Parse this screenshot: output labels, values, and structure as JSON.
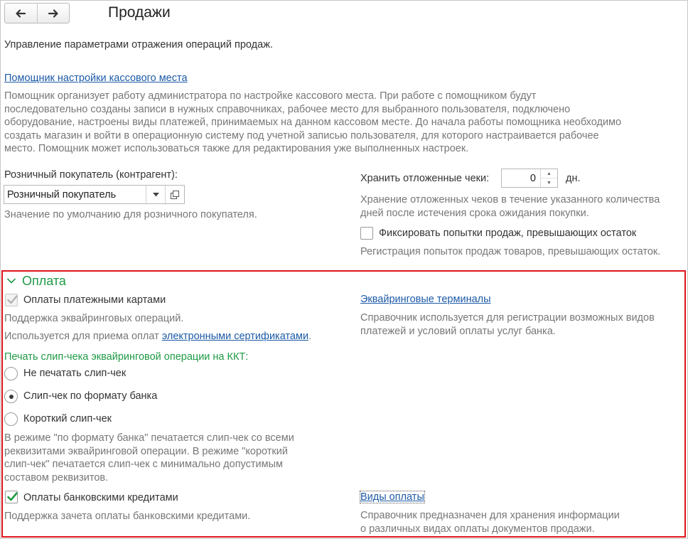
{
  "header": {
    "title": "Продажи",
    "back_icon": "arrow-left-icon",
    "forward_icon": "arrow-right-icon"
  },
  "description": "Управление параметрами отражения операций продаж.",
  "assistant": {
    "link": "Помощник настройки кассового места",
    "text_lines": [
      "Помощник организует работу администратора по настройке кассового места. При работе с помощником будут",
      "последовательно созданы записи в нужных справочниках, рабочее место для выбранного пользователя, подключено",
      "оборудование, настроены виды платежей, принимаемых на данном кассовом месте. До начала работы помощника необходимо",
      "создать магазин и войти в операционную систему под учетной записью пользователя, для которого настраивается рабочее",
      "место. Помощник может использоваться также для редактирования уже выполненных настроек."
    ]
  },
  "retail_buyer": {
    "label": "Розничный покупатель (контрагент):",
    "value": "Розничный покупатель",
    "hint": "Значение по умолчанию для розничного покупателя."
  },
  "deferred_checks": {
    "label": "Хранить отложенные чеки:",
    "value": "0",
    "unit": "дн.",
    "hint_lines": [
      "Хранение отложенных чеков в течение указанного количества",
      "дней после истечения срока ожидания покупки."
    ]
  },
  "fix_attempts": {
    "label": "Фиксировать попытки продаж, превышающих остаток",
    "checked": false,
    "hint": "Регистрация попыток продаж товаров, превышающих остаток."
  },
  "payment_group": {
    "title": "Оплата",
    "card_payments": {
      "label": "Оплаты платежными картами",
      "checked": true,
      "disabled": true,
      "hint": "Поддержка эквайринговых операций.",
      "usage_prefix": "Используется для приема оплат ",
      "usage_link": "электронными сертификатами",
      "usage_suffix": "."
    },
    "terminals": {
      "link": "Эквайринговые терминалы",
      "hint_lines": [
        "Справочник используется для регистрации возможных видов",
        "платежей и условий оплаты услуг банка."
      ]
    },
    "slip": {
      "label": "Печать слип-чека эквайринговой операции на ККТ:",
      "selected": "Слип-чек по формату банка",
      "options": [
        "Не печатать слип-чек",
        "Слип-чек по формату банка",
        "Короткий слип-чек"
      ],
      "hint_lines": [
        "В режиме \"по формату банка\" печатается слип-чек со всеми",
        "реквизитами эквайринговой операции. В режиме \"короткий",
        "слип-чек\" печатается слип-чек с минимально допустимым",
        "составом реквизитов."
      ]
    },
    "credits": {
      "label": "Оплаты банковскими кредитами",
      "checked": true,
      "hint": "Поддержка зачета оплаты банковскими кредитами."
    },
    "payment_types": {
      "link": "Виды оплаты",
      "hint_lines": [
        "Справочник предназначен для хранения информации",
        "о различных видах оплаты документов продажи."
      ]
    }
  },
  "colors": {
    "link": "#1c5aa6",
    "group_title": "#1f9a46",
    "highlight_border": "#e0141c",
    "hint_text": "#777777"
  }
}
